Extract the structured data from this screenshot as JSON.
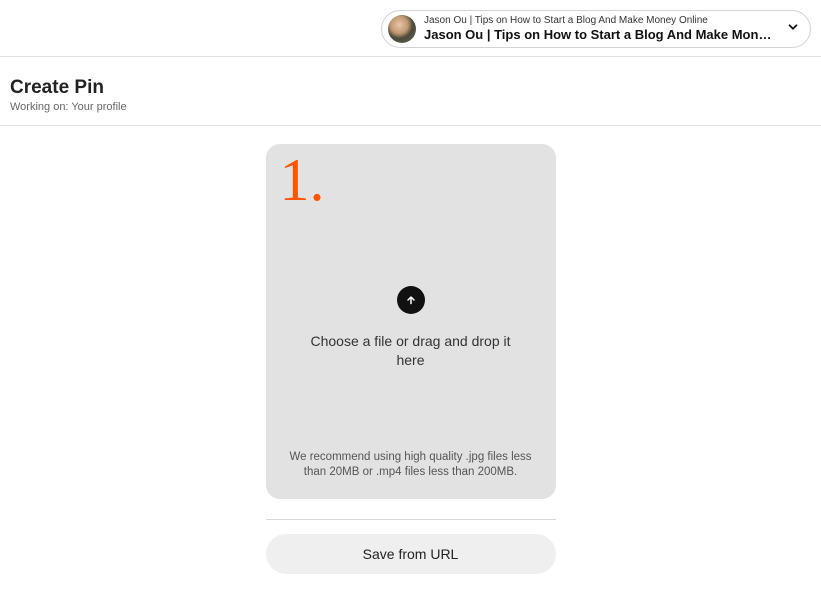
{
  "profile": {
    "small_label": "Jason Ou | Tips on How to Start a Blog And Make Money Online",
    "large_label": "Jason Ou | Tips on How to Start a Blog And Make Money Online"
  },
  "header": {
    "title": "Create Pin",
    "subtitle": "Working on: Your profile"
  },
  "dropzone": {
    "annotation": "1.",
    "prompt": "Choose a file or drag and drop it here",
    "recommendation": "We recommend using high quality .jpg files less than 20MB or .mp4 files less than 200MB."
  },
  "actions": {
    "save_from_url": "Save from URL"
  }
}
